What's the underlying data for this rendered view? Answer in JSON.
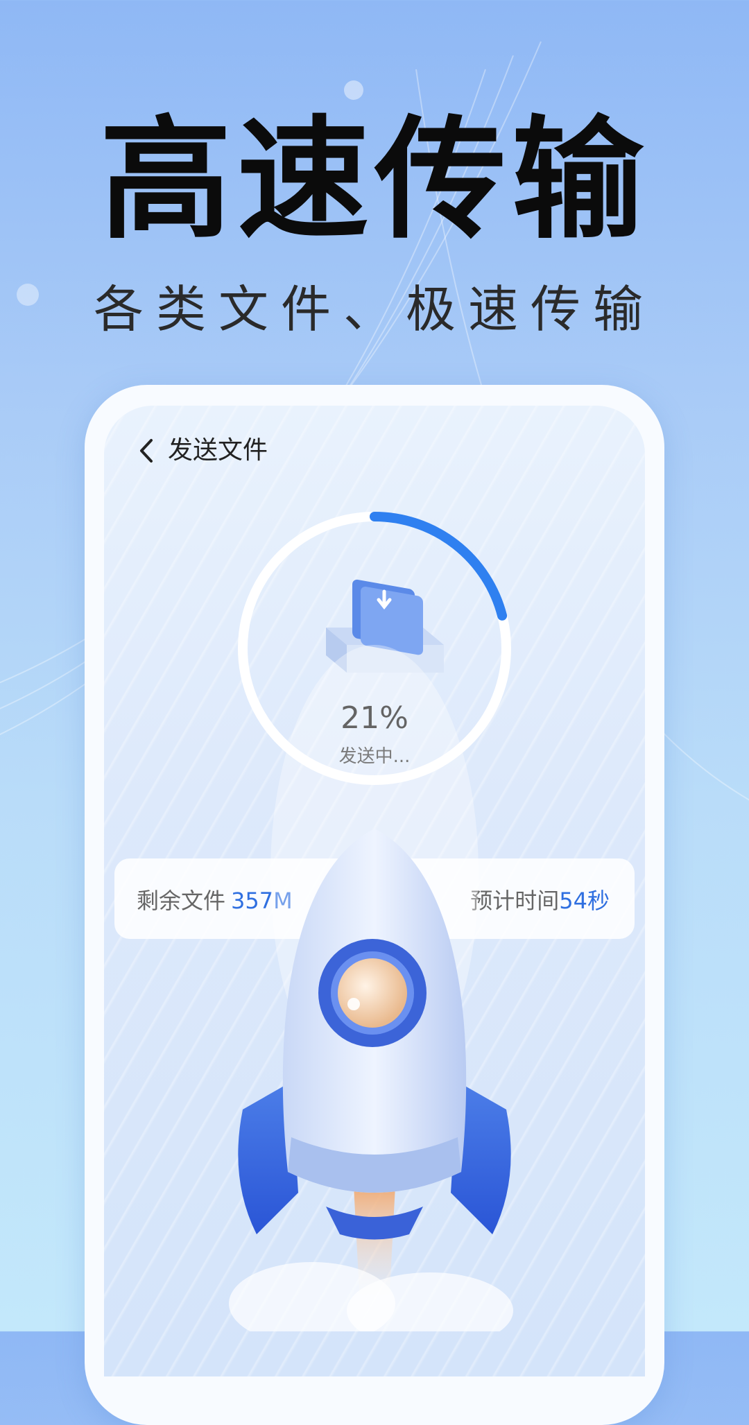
{
  "headline": "高速传输",
  "subheadline": "各类文件、极速传输",
  "screen": {
    "title": "发送文件",
    "progress_percent": 21,
    "progress_label": "21%",
    "status_text": "发送中...",
    "remaining_label": "剩余文件",
    "remaining_value": "357M",
    "eta_label": "预计时间",
    "eta_value": "54秒"
  },
  "colors": {
    "accent": "#2f6fe0",
    "ring_track": "#ffffff",
    "ring_progress": "#2f80f0"
  },
  "icons": [
    "back-chevron-icon",
    "folder-download-icon",
    "rocket-illustration"
  ]
}
